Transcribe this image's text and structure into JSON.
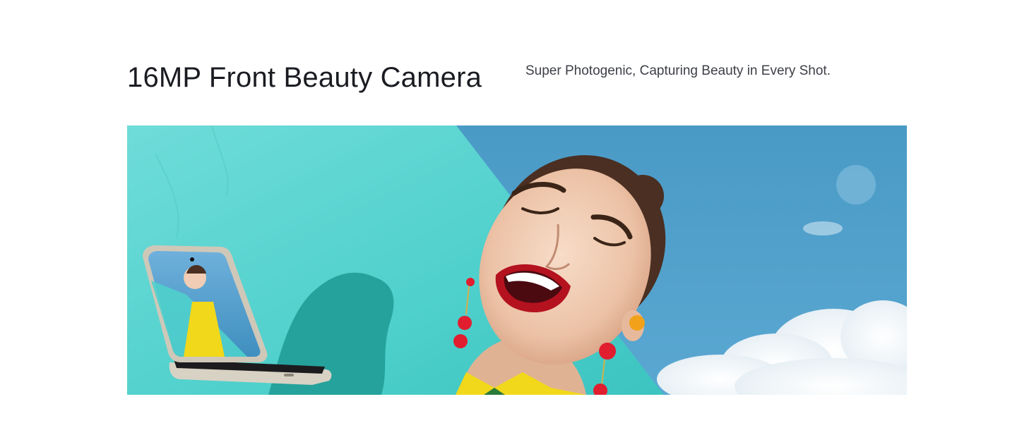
{
  "feature": {
    "title": "16MP Front Beauty Camera",
    "tagline": "Super Photogenic, Capturing Beauty in Every Shot."
  },
  "banner": {
    "image": "woman-laughing-with-flip-phone-selfie",
    "colors": {
      "sky": "#4f9fc9",
      "wall": "#5fd6d3",
      "shadow": "#1f9a94",
      "lips": "#b4121e",
      "earring": "#e01e2f"
    }
  }
}
